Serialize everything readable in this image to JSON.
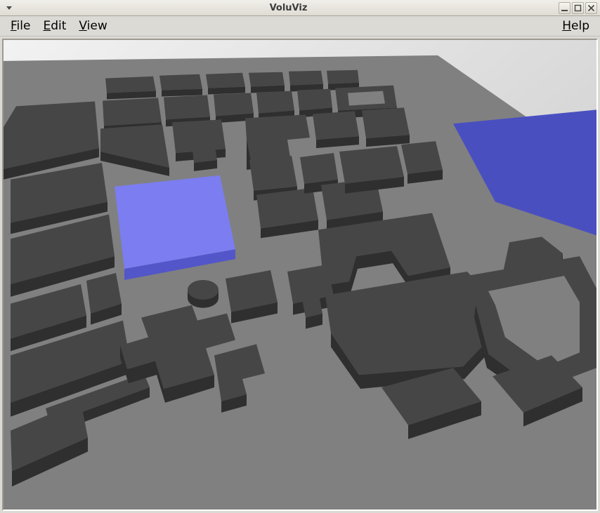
{
  "window": {
    "title": "VoluViz"
  },
  "menu": {
    "file": {
      "mnemonic": "F",
      "rest": "ile"
    },
    "edit": {
      "mnemonic": "E",
      "rest": "dit"
    },
    "view": {
      "mnemonic": "V",
      "rest": "iew"
    },
    "help": {
      "mnemonic": "H",
      "rest": "elp"
    }
  },
  "scene": {
    "ground_color": "#808080",
    "sky_gradient_top": "#eaeaea",
    "sky_gradient_bottom": "#c9c9c9",
    "building_top": "#464646",
    "building_side": "#2f2f2f",
    "highlight_top": "#7b7df0",
    "highlight_side": "#5658c4",
    "highlight_right_top": "#4a4fc0"
  }
}
